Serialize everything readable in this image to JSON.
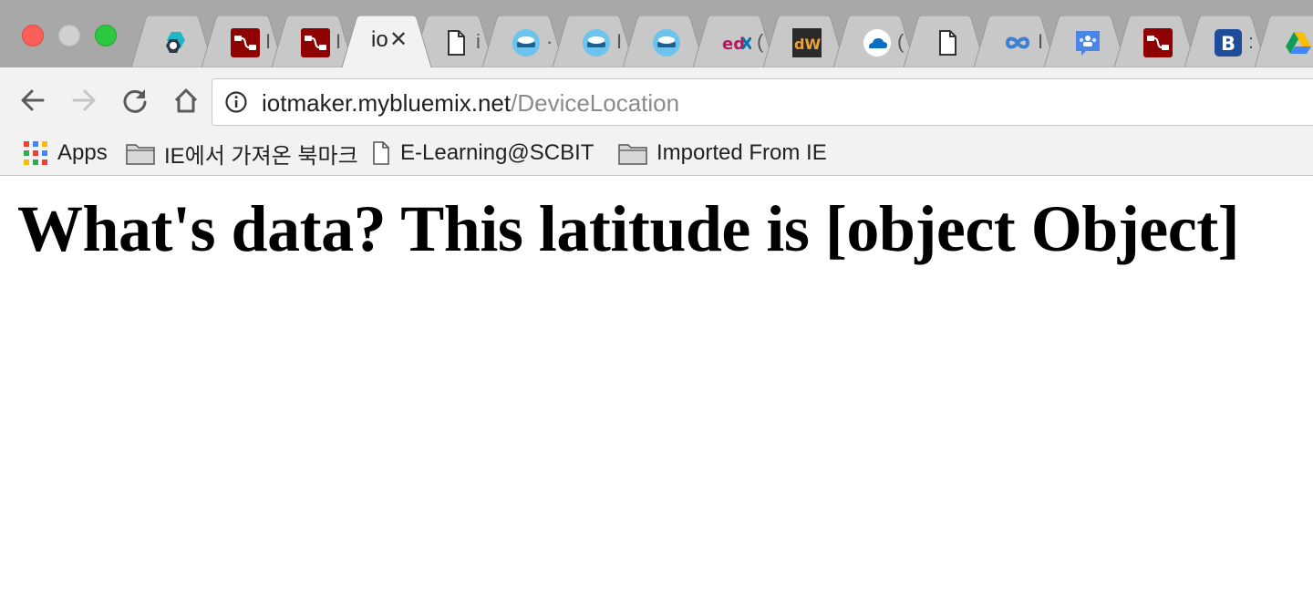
{
  "window": {
    "buttons": [
      "close",
      "minimize",
      "zoom"
    ]
  },
  "tabs": [
    {
      "icon": "hexagon-logo-icon",
      "stub": ""
    },
    {
      "icon": "node-red-icon",
      "stub": "I"
    },
    {
      "icon": "node-red-icon",
      "stub": "I"
    },
    {
      "icon": "text-favicon",
      "stub": "io",
      "active": true
    },
    {
      "icon": "document-icon",
      "stub": "i"
    },
    {
      "icon": "cloud-disk-icon",
      "stub": "·"
    },
    {
      "icon": "cloud-disk-icon",
      "stub": "I"
    },
    {
      "icon": "cloud-disk-icon",
      "stub": ""
    },
    {
      "icon": "edx-logo-icon",
      "stub": "("
    },
    {
      "icon": "developerworks-icon",
      "stub": ""
    },
    {
      "icon": "onedrive-icon",
      "stub": "("
    },
    {
      "icon": "document-icon",
      "stub": ""
    },
    {
      "icon": "infinity-icon",
      "stub": "I"
    },
    {
      "icon": "classroom-icon",
      "stub": ""
    },
    {
      "icon": "node-red-icon",
      "stub": ""
    },
    {
      "icon": "bootstrap-b-icon",
      "stub": ":"
    },
    {
      "icon": "google-drive-icon",
      "stub": ""
    }
  ],
  "active_tab_stub": "io",
  "address_bar": {
    "host": "iotmaker.mybluemix.net",
    "path": "/DeviceLocation"
  },
  "bookmarks": [
    {
      "label": "Apps",
      "icon": "apps-grid-icon"
    },
    {
      "label": "IE에서 가져온 북마크",
      "icon": "folder-icon"
    },
    {
      "label": "E-Learning@SCBIT",
      "icon": "page-icon"
    },
    {
      "label": "Imported From IE",
      "icon": "folder-icon"
    }
  ],
  "page": {
    "heading": "What's data? This latitude is [object Object]"
  }
}
